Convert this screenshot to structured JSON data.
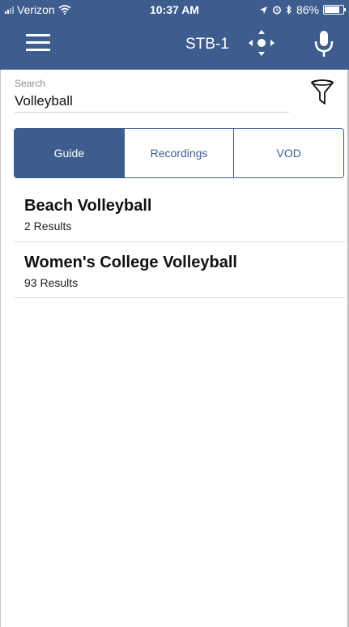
{
  "status_bar": {
    "carrier": "Verizon",
    "time": "10:37 AM",
    "battery": "86%"
  },
  "header": {
    "device": "STB-1",
    "icons": [
      "hamburger-menu-icon",
      "dpad-remote-icon",
      "microphone-icon"
    ]
  },
  "search": {
    "label": "Search",
    "value": "Volleyball"
  },
  "filter_icon": "filter-funnel-icon",
  "tabs": [
    {
      "label": "Guide",
      "active": true
    },
    {
      "label": "Recordings",
      "active": false
    },
    {
      "label": "VOD",
      "active": false
    }
  ],
  "results": [
    {
      "title": "Beach Volleyball",
      "count": "2 Results"
    },
    {
      "title": "Women's College Volleyball",
      "count": "93 Results"
    }
  ],
  "colors": {
    "primary": "#3d5d8e",
    "background": "#ffffff"
  }
}
